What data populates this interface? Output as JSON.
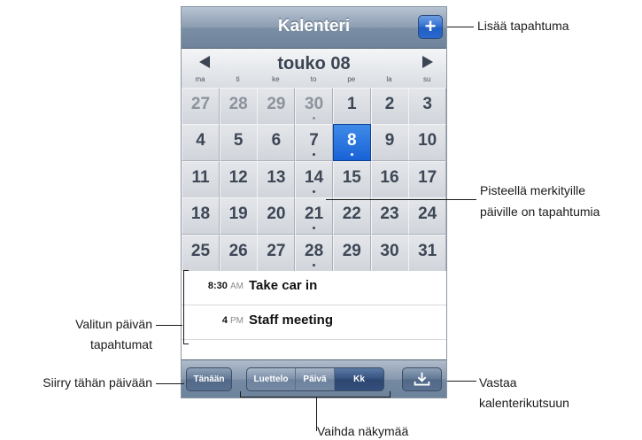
{
  "screen": {
    "title": "Kalenteri",
    "add_button": "+",
    "month_title": "touko 08",
    "weekdays": [
      "ma",
      "ti",
      "ke",
      "to",
      "pe",
      "la",
      "su"
    ],
    "weeks": [
      [
        {
          "d": "27",
          "other": true
        },
        {
          "d": "28",
          "other": true
        },
        {
          "d": "29",
          "other": true
        },
        {
          "d": "30",
          "other": true,
          "dot": true
        },
        {
          "d": "1"
        },
        {
          "d": "2"
        },
        {
          "d": "3"
        }
      ],
      [
        {
          "d": "4"
        },
        {
          "d": "5"
        },
        {
          "d": "6"
        },
        {
          "d": "7",
          "dot": true
        },
        {
          "d": "8",
          "selected": true,
          "dot": true
        },
        {
          "d": "9"
        },
        {
          "d": "10"
        }
      ],
      [
        {
          "d": "11"
        },
        {
          "d": "12"
        },
        {
          "d": "13"
        },
        {
          "d": "14",
          "dot": true
        },
        {
          "d": "15"
        },
        {
          "d": "16"
        },
        {
          "d": "17"
        }
      ],
      [
        {
          "d": "18"
        },
        {
          "d": "19"
        },
        {
          "d": "20"
        },
        {
          "d": "21",
          "dot": true
        },
        {
          "d": "22"
        },
        {
          "d": "23"
        },
        {
          "d": "24"
        }
      ],
      [
        {
          "d": "25"
        },
        {
          "d": "26"
        },
        {
          "d": "27"
        },
        {
          "d": "28",
          "dot": true
        },
        {
          "d": "29"
        },
        {
          "d": "30"
        },
        {
          "d": "31"
        }
      ]
    ],
    "events": [
      {
        "time": "8:30",
        "ampm": "AM",
        "title": "Take car in"
      },
      {
        "time": "4",
        "ampm": "PM",
        "title": "Staff meeting"
      }
    ],
    "toolbar": {
      "today": "Tänään",
      "views": [
        "Luettelo",
        "Päivä",
        "Kk"
      ],
      "active_view": "Kk",
      "sync_icon": "download-tray-icon"
    }
  },
  "callouts": {
    "add_event": "Lisää tapahtuma",
    "dots_line1": "Pisteellä merkityille",
    "dots_line2": "päiville on tapahtumia",
    "selected_day_line1": "Valitun päivän",
    "selected_day_line2": "tapahtumat",
    "go_today": "Siirry tähän päivään",
    "respond_line1": "Vastaa",
    "respond_line2": "kalenterikutsuun",
    "switch_view": "Vaihda näkymää"
  },
  "colors": {
    "bar_blue": "#7a8ea5",
    "selected_day": "#1862d6",
    "add_button": "#2f6fd0"
  }
}
